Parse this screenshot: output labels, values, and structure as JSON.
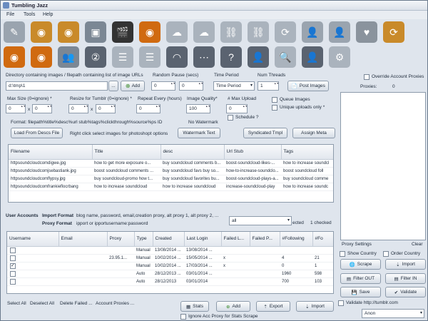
{
  "window": {
    "title": "Tumbling Jazz"
  },
  "menu": [
    "File",
    "Tools",
    "Help"
  ],
  "toolbar_row1": [
    {
      "icon": "tumblr-pen-icon",
      "color": "#9aa4af"
    },
    {
      "icon": "rss-import-icon",
      "color": "#c98a2a"
    },
    {
      "icon": "rss-export-icon",
      "color": "#c98a2a"
    },
    {
      "icon": "image-gallery-icon",
      "color": "#7b8794"
    },
    {
      "icon": "clapperboard-icon",
      "color": "#333"
    },
    {
      "icon": "rss-feed-icon",
      "color": "#d06a10"
    },
    {
      "icon": "cloud-upload-icon",
      "color": "#aab3bd"
    },
    {
      "icon": "cloud-download-icon",
      "color": "#aab3bd"
    },
    {
      "icon": "link-icon",
      "color": "#aab3bd"
    },
    {
      "icon": "link-broken-icon",
      "color": "#aab3bd"
    },
    {
      "icon": "refresh-cycle-icon",
      "color": "#aab3bd"
    },
    {
      "icon": "user-account-icon",
      "color": "#9aa4af"
    },
    {
      "icon": "user-remove-icon",
      "color": "#9aa4af"
    },
    {
      "icon": "heart-icon",
      "color": "#8a939d"
    },
    {
      "icon": "reblog-cycle-icon",
      "color": "#c98a2a"
    }
  ],
  "toolbar_row2": [
    {
      "icon": "rss-settings-icon",
      "color": "#d06a10"
    },
    {
      "icon": "rss-stop-icon",
      "color": "#d06a10"
    },
    {
      "icon": "user-add-icon",
      "color": "#7b8794"
    },
    {
      "icon": "numbered-user-icon",
      "color": "#5a6370"
    },
    {
      "icon": "list-grid-icon",
      "color": "#aab3bd"
    },
    {
      "icon": "list-export-icon",
      "color": "#aab3bd"
    },
    {
      "icon": "wifi-signal-icon",
      "color": "#5a6370"
    },
    {
      "icon": "ellipsis-chat-icon",
      "color": "#5a6370"
    },
    {
      "icon": "question-help-icon",
      "color": "#5a6370"
    },
    {
      "icon": "user-stats-icon",
      "color": "#5a6370"
    },
    {
      "icon": "magnifier-search-icon",
      "color": "#aab3bd"
    },
    {
      "icon": "user-profile-icon",
      "color": "#5a6370"
    },
    {
      "icon": "robot-android-icon",
      "color": "#aab3bd"
    }
  ],
  "dir": {
    "label": "Directory containing images / filepath containing list of image URLs",
    "value": "d:\\tmp\\1",
    "browse": "...",
    "add": "Add"
  },
  "pause": {
    "label": "Random Pause (secs)",
    "from": "0",
    "to": "0"
  },
  "period": {
    "label": "Time Period",
    "value": "Time Period"
  },
  "threads": {
    "label": "Num Threads",
    "value": "1"
  },
  "post_images": "Post Images",
  "override_proxies": "Override Account Proxies",
  "proxies_label": "Proxies:",
  "proxies_count": "0",
  "max_size": {
    "label": "Max Size (0=ignore) *",
    "w": "0",
    "h": "0",
    "x": "x"
  },
  "resize": {
    "label": "Resize for Tumblr (0=ignore) *",
    "w": "0",
    "h": "0",
    "x": "x"
  },
  "repeat": {
    "label": "Repeat Every (hours)",
    "value": "0"
  },
  "quality": {
    "label": "Image Quality*",
    "value": "100"
  },
  "max_upload": {
    "label": "# Max Upload",
    "value": "0"
  },
  "queue_images": "Queue Images",
  "unique_uploads": "Unique uploads only *",
  "schedule": "Schedule ?",
  "format_text": "Format: filepath%title%desc%url stub%tags%clickthrough%source%ps ID",
  "no_watermark": "No Watermark",
  "load_descs": "Load From Descs File",
  "right_click_hint": "Right click select images for photoshopt options",
  "watermark_text": "Watermark Text",
  "syndicated": "Syndicated Tmpl",
  "assign_meta": "Assign Meta",
  "images_table": {
    "headers": [
      "Filename",
      "Title",
      "desc",
      "Url Stub",
      "Tags"
    ],
    "rows": [
      [
        "httpsoundcloudcomdigwe.jpg",
        "how to get more exposure o...",
        "buy soundcloud comments b...",
        "boost-soundcloud-likes-...",
        "how to increase soundcl"
      ],
      [
        "httpsoundcloudcomjsebastiank.jpg",
        "boost soundcloud comments ...",
        "buy soundcloud favs buy so...",
        "how-to-increase-soundclo...",
        "boost soundcloud foll"
      ],
      [
        "httpsoundcloudcomflypsy.jpg",
        "buy soundcloud-promo  how t...",
        "buy soundcloud favorites bu...",
        "boost-soundcloud-plays-a...",
        "buy soundcloud comme"
      ],
      [
        "httpsoundcloudcomfrankieflocrbang",
        "how to increase soundcloud",
        "how to increase soundcloud",
        "increase-soundcloud-play",
        "how to increase soundc"
      ]
    ]
  },
  "user_accounts_label": "User Accounts",
  "import_format_label": "Import Format",
  "import_format_value": "blog name, password, email,creation proxy, alt proxy 1, alt proxy 2, ...",
  "proxy_format_label": "Proxy Format",
  "proxy_format_value": "ipport  or  ipportusername:password",
  "filter_select": "all",
  "selected_suffix": "ected",
  "checked_count": "1 checked",
  "accounts_table": {
    "headers": [
      "Username",
      "Email",
      "Proxy",
      "Type",
      "Created",
      "Last Login",
      "Failed L...",
      "Failed P...",
      "#Following",
      "#Fo"
    ],
    "rows": [
      {
        "checked": false,
        "cells": [
          "",
          "",
          "",
          "Manual",
          "13/08/2014 ...",
          "13/08/2014 ...",
          "",
          "",
          "",
          ""
        ]
      },
      {
        "checked": false,
        "cells": [
          "",
          "",
          "23.95.1...",
          "Manual",
          "10/02/2014 ...",
          "15/05/2014 ...",
          "x",
          "",
          "4",
          "21"
        ]
      },
      {
        "checked": true,
        "cells": [
          "",
          "",
          "",
          "Manual",
          "10/02/2014 ...",
          "17/03/2014 ...",
          "x",
          "",
          "0",
          "1"
        ]
      },
      {
        "checked": false,
        "cells": [
          "",
          "",
          "",
          "Auto",
          "28/12/2013 ...",
          "03/01/2014 ...",
          "",
          "",
          "1960",
          "598"
        ]
      },
      {
        "checked": false,
        "cells": [
          "",
          "",
          "",
          "Auto",
          "28/12/2013",
          "03/01/2014",
          "",
          "",
          "700",
          "103"
        ]
      }
    ]
  },
  "right_panel": {
    "proxy_settings": "Proxy Settings",
    "clear": "Clear",
    "show_country": "Show Country",
    "order_country": "Order Country",
    "scrape": "Scrape",
    "import": "Import",
    "filter_out": "Filter OUT",
    "filter_in": "Filter IN",
    "save": "Save",
    "validate": "Validate",
    "validate_url": "Validate http://tumblr.com",
    "anon_select": "Anon"
  },
  "bottom": {
    "select_all": "Select All",
    "deselect_all": "Deselect All",
    "delete_failed": "Delete Failed ...",
    "account_proxies": "Account Proxies ...",
    "stats": "Stats",
    "add": "Add",
    "export": "Export",
    "import": "Import",
    "ignore_proxy": "Ignore Acc Proxy for Stats Scrape"
  }
}
